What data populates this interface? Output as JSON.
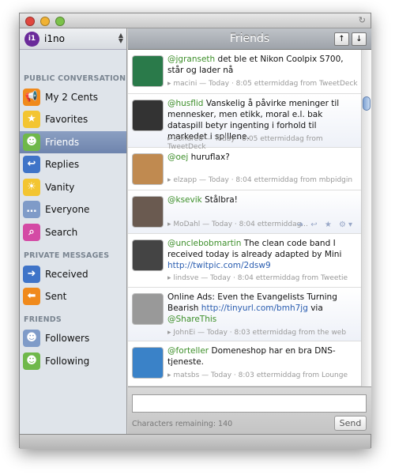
{
  "window": {
    "refresh_icon": "refresh-icon"
  },
  "account": {
    "name": "i1no",
    "logo": "i1"
  },
  "sidebar": {
    "sections": [
      {
        "title": "PUBLIC CONVERSATION",
        "items": [
          {
            "label": "My 2 Cents",
            "icon": "megaphone-icon",
            "color": "#f08a1c"
          },
          {
            "label": "Favorites",
            "icon": "star-icon",
            "color": "#f3c531"
          },
          {
            "label": "Friends",
            "icon": "friends-icon",
            "color": "#6fb84a",
            "selected": true
          },
          {
            "label": "Replies",
            "icon": "reply-arrow-icon",
            "color": "#3f74c8"
          },
          {
            "label": "Vanity",
            "icon": "sun-icon",
            "color": "#f3c531"
          },
          {
            "label": "Everyone",
            "icon": "blah-bubble-icon",
            "color": "#7f9bc8"
          },
          {
            "label": "Search",
            "icon": "magnifier-icon",
            "color": "#d44aa5"
          }
        ]
      },
      {
        "title": "PRIVATE MESSAGES",
        "items": [
          {
            "label": "Received",
            "icon": "arrow-right-icon",
            "color": "#3f74c8"
          },
          {
            "label": "Sent",
            "icon": "arrow-left-icon",
            "color": "#f08a1c"
          }
        ]
      },
      {
        "title": "FRIENDS",
        "items": [
          {
            "label": "Followers",
            "icon": "followers-icon",
            "color": "#7f9bc8"
          },
          {
            "label": "Following",
            "icon": "following-icon",
            "color": "#6fb84a"
          }
        ]
      }
    ]
  },
  "header": {
    "title": "Friends",
    "up": "↑",
    "down": "↓"
  },
  "tweets": [
    {
      "mention": "@jgranseth",
      "text": " det ble et Nikon Coolpix S700, står og lader nå",
      "meta": "macini — Today · 8:05 ettermiddag from TweetDeck",
      "avatar": "#2a7a4a"
    },
    {
      "mention": "@husflid",
      "text": " Vanskelig å påvirke meninger til mennesker, men etikk, moral e.l. bak dataspill betyr ingenting i forhold til markedet i spillene.",
      "meta": "Sondre8 — Today · 8:05 ettermiddag from TweetDeck",
      "avatar": "#333"
    },
    {
      "mention": "@oej",
      "text": " huruflax?",
      "meta": "elzapp — Today · 8:04 ettermiddag from mbpidgin",
      "avatar": "#c08a50"
    },
    {
      "mention": "@ksevik",
      "text": " Stålbra!",
      "meta": "MoDahl — Today · 8:04 ettermiddag...",
      "avatar": "#6a5a50",
      "actions": "➜ ↩ ★ ⚙▾"
    },
    {
      "mention": "@unclebobmartin",
      "text": " The clean code band I received today is already adapted by Mini ",
      "link": "http://twitpic.com/2dsw9",
      "meta": "lindsve — Today · 8:04 ettermiddag from Tweetie",
      "avatar": "#444"
    },
    {
      "text": "Online Ads: Even the Evangelists Turning Bearish ",
      "link": "http://tinyurl.com/bmh7jg",
      "text2": " via ",
      "mention2": "@ShareThis",
      "meta": "JohnEi — Today · 8:03 ettermiddag from the web",
      "avatar": "#999"
    },
    {
      "mention": "@forteller",
      "text": " Domeneshop har en bra DNS-tjeneste.",
      "meta": "matsbs — Today · 8:03 ettermiddag from Lounge",
      "avatar": "#3a82c8"
    }
  ],
  "compose": {
    "value": "",
    "remaining": "Characters remaining: 140",
    "send": "Send"
  }
}
